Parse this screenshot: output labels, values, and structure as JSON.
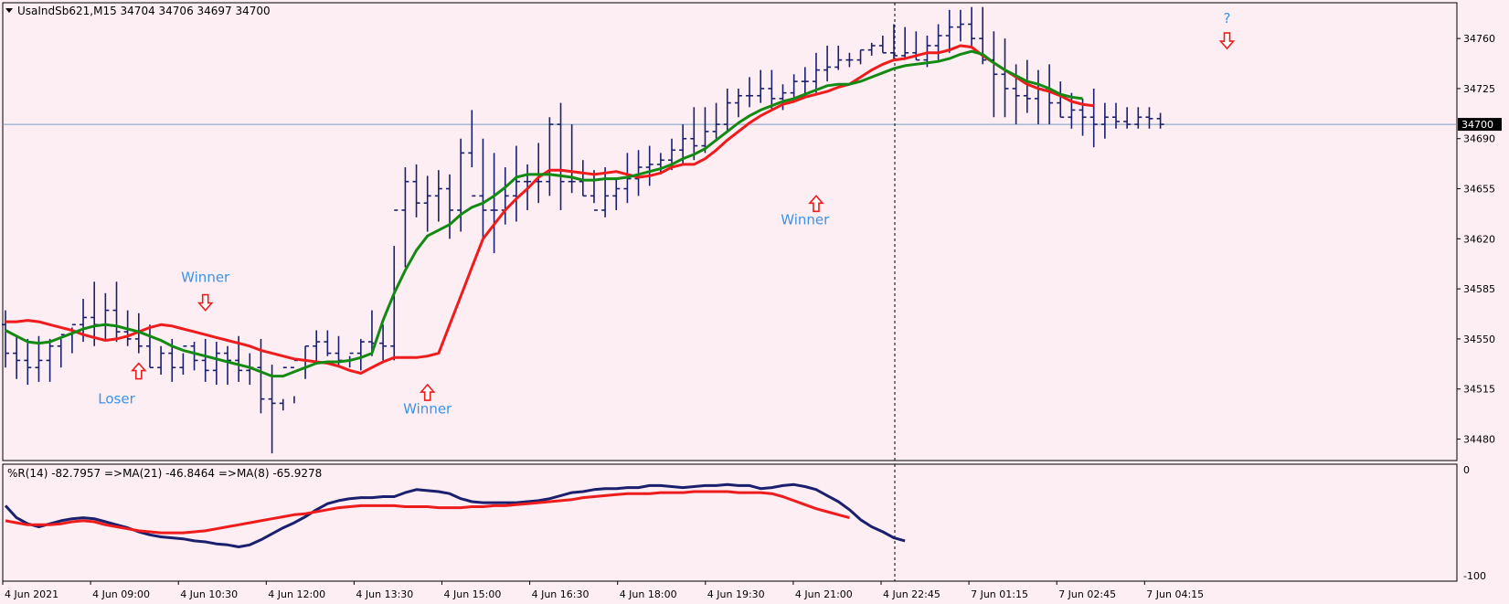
{
  "colors": {
    "background": "#fdeef3",
    "frame": "#000000",
    "bars": "#1a1f6e",
    "ma_fast": "#138a13",
    "ma_slow": "#ee1c1c",
    "wpr": "#1a1f6e",
    "wpr_ma": "#ee1c1c",
    "annotation_text": "#3b93e6",
    "arrow": "#ee1c1c",
    "price_line": "#7a9cc0",
    "price_tag_bg": "#000000",
    "price_tag_text": "#ffffff"
  },
  "header": {
    "symbol_info": "UsaIndSb621,M15  34704 34706 34697 34700",
    "collapse_icon": "triangle-down-icon"
  },
  "chart_data": [
    {
      "type": "ohlc",
      "panel": "main",
      "title": "UsaIndSb621,M15  34704 34706 34697 34700",
      "ylim": [
        34465,
        34785
      ],
      "y_ticks": [
        "34760",
        "34725",
        "34690",
        "34655",
        "34620",
        "34585",
        "34550",
        "34515",
        "34480"
      ],
      "current_price": {
        "value": 34700,
        "label": "34700"
      },
      "x_ticks": [
        "4 Jun 2021",
        "4 Jun 09:00",
        "4 Jun 10:30",
        "4 Jun 12:00",
        "4 Jun 13:30",
        "4 Jun 15:00",
        "4 Jun 16:30",
        "4 Jun 18:00",
        "4 Jun 19:30",
        "4 Jun 21:00",
        "4 Jun 22:45",
        "7 Jun 01:15",
        "7 Jun 02:45",
        "7 Jun 04:15"
      ],
      "bars_high": [
        34570,
        34552,
        34550,
        34552,
        34550,
        34550,
        34558,
        34578,
        34590,
        34582,
        34590,
        34570,
        34568,
        34560,
        34545,
        34550,
        34540,
        34548,
        34550,
        34548,
        34545,
        34552,
        34540,
        34550,
        34532,
        34508,
        34510,
        34545,
        34556,
        34556,
        34552,
        34538,
        34550,
        34570,
        34560,
        34615,
        34670,
        34672,
        34664,
        34668,
        34665,
        34690,
        34710,
        34690,
        34680,
        34670,
        34685,
        34672,
        34687,
        34705,
        34715,
        34700,
        34675,
        34668,
        34670,
        34662,
        34680,
        34682,
        34685,
        34680,
        34690,
        34700,
        34712,
        34712,
        34715,
        34725,
        34725,
        34733,
        34738,
        34738,
        34728,
        34735,
        34740,
        34750,
        34755,
        34755,
        34750,
        34752,
        34757,
        34762,
        34770,
        34768,
        34765,
        34762,
        34770,
        34780,
        34780,
        34782,
        34782,
        34765,
        34760,
        34742,
        34745,
        34738,
        34742,
        34730,
        34722,
        34718,
        34725,
        34715,
        34715,
        34712,
        34712,
        34712,
        34708
      ],
      "bars_low": [
        34530,
        34522,
        34518,
        34520,
        34520,
        34530,
        34540,
        34548,
        34545,
        34550,
        34548,
        34545,
        34540,
        34530,
        34525,
        34520,
        34525,
        34528,
        34520,
        34518,
        34518,
        34520,
        34518,
        34498,
        34470,
        34500,
        34505,
        34522,
        34532,
        34538,
        34530,
        34530,
        34528,
        34538,
        34535,
        34535,
        34600,
        34635,
        34625,
        34632,
        34620,
        34625,
        34670,
        34620,
        34610,
        34630,
        34632,
        34640,
        34645,
        34650,
        34640,
        34652,
        34650,
        34645,
        34635,
        34640,
        34645,
        34650,
        34657,
        34665,
        34668,
        34672,
        34675,
        34680,
        34690,
        34695,
        34705,
        34712,
        34715,
        34710,
        34710,
        34718,
        34720,
        34722,
        34730,
        34738,
        34740,
        34742,
        34748,
        34750,
        34745,
        34745,
        34745,
        34740,
        34745,
        34750,
        34758,
        34755,
        34742,
        34705,
        34705,
        34700,
        34708,
        34700,
        34700,
        34705,
        34697,
        34692,
        34684,
        34690,
        34697,
        34697,
        34697,
        34697,
        34697
      ],
      "bars_open": [
        34560,
        34540,
        34535,
        34530,
        34535,
        34545,
        34553,
        34560,
        34565,
        34560,
        34570,
        34555,
        34550,
        34545,
        34530,
        34540,
        34530,
        34545,
        34535,
        34528,
        34540,
        34535,
        34528,
        34530,
        34508,
        34505,
        34530,
        34535,
        34545,
        34548,
        34540,
        34535,
        34540,
        34548,
        34547,
        34545,
        34640,
        34660,
        34645,
        34650,
        34655,
        34640,
        34680,
        34650,
        34640,
        34640,
        34650,
        34660,
        34660,
        34660,
        34700,
        34660,
        34660,
        34650,
        34640,
        34650,
        34655,
        34662,
        34670,
        34672,
        34675,
        34682,
        34690,
        34685,
        34695,
        34700,
        34715,
        34720,
        34720,
        34725,
        34718,
        34722,
        34730,
        34730,
        34738,
        34740,
        34745,
        34745,
        34752,
        34755,
        34750,
        34748,
        34750,
        34745,
        34755,
        34762,
        34768,
        34770,
        34760,
        34745,
        34735,
        34725,
        34720,
        34718,
        34725,
        34715,
        34705,
        34710,
        34705,
        34700,
        34705,
        34702,
        34700,
        34705,
        34704
      ],
      "bars_close": [
        34540,
        34535,
        34530,
        34535,
        34545,
        34553,
        34560,
        34565,
        34560,
        34570,
        34555,
        34550,
        34545,
        34530,
        34540,
        34530,
        34545,
        34535,
        34528,
        34540,
        34535,
        34528,
        34530,
        34508,
        34505,
        34530,
        34535,
        34545,
        34548,
        34540,
        34535,
        34540,
        34548,
        34547,
        34545,
        34640,
        34660,
        34645,
        34650,
        34655,
        34640,
        34680,
        34650,
        34640,
        34640,
        34650,
        34660,
        34660,
        34660,
        34700,
        34660,
        34660,
        34650,
        34640,
        34650,
        34655,
        34662,
        34670,
        34672,
        34675,
        34682,
        34690,
        34685,
        34695,
        34700,
        34715,
        34720,
        34720,
        34725,
        34718,
        34722,
        34730,
        34730,
        34738,
        34740,
        34745,
        34745,
        34752,
        34755,
        34750,
        34748,
        34750,
        34745,
        34755,
        34762,
        34768,
        34770,
        34760,
        34745,
        34735,
        34725,
        34720,
        34718,
        34725,
        34715,
        34705,
        34710,
        34705,
        34700,
        34705,
        34702,
        34700,
        34705,
        34704,
        34700
      ],
      "ma_fast": [
        34556,
        34552,
        34548,
        34547,
        34548,
        34551,
        34554,
        34557,
        34559,
        34560,
        34559,
        34557,
        34555,
        34552,
        34549,
        34545,
        34542,
        34540,
        34538,
        34536,
        34534,
        34532,
        34530,
        34527,
        34524,
        34524,
        34527,
        34530,
        34533,
        34534,
        34534,
        34535,
        34537,
        34540,
        34563,
        34582,
        34598,
        34612,
        34622,
        34626,
        34630,
        34637,
        34642,
        34645,
        34650,
        34656,
        34663,
        34665,
        34665,
        34665,
        34664,
        34663,
        34661,
        34661,
        34662,
        34662,
        34663,
        34665,
        34667,
        34669,
        34672,
        34676,
        34679,
        34683,
        34689,
        34695,
        34701,
        34706,
        34710,
        34713,
        34716,
        34718,
        34721,
        34724,
        34727,
        34728,
        34728,
        34730,
        34733,
        34736,
        34739,
        34741,
        34742,
        34743,
        34744,
        34746,
        34749,
        34751,
        34749,
        34743,
        34738,
        34734,
        34730,
        34728,
        34725,
        34721,
        34719,
        34718
      ],
      "ma_slow": [
        34562,
        34562,
        34563,
        34562,
        34560,
        34558,
        34556,
        34553,
        34551,
        34549,
        34550,
        34552,
        34555,
        34558,
        34560,
        34559,
        34557,
        34555,
        34553,
        34551,
        34549,
        34547,
        34545,
        34542,
        34540,
        34538,
        34536,
        34535,
        34534,
        34533,
        34531,
        34528,
        34526,
        34530,
        34534,
        34537,
        34537,
        34537,
        34538,
        34540,
        34560,
        34580,
        34600,
        34620,
        34630,
        34640,
        34648,
        34655,
        34663,
        34668,
        34668,
        34667,
        34666,
        34665,
        34666,
        34667,
        34665,
        34663,
        34664,
        34666,
        34670,
        34672,
        34672,
        34676,
        34682,
        34689,
        34695,
        34701,
        34706,
        34710,
        34714,
        34716,
        34719,
        34721,
        34723,
        34726,
        34728,
        34733,
        34738,
        34742,
        34745,
        34746,
        34748,
        34750,
        34750,
        34752,
        34755,
        34754,
        34748,
        34743,
        34738,
        34733,
        34728,
        34725,
        34723,
        34720,
        34716,
        34714,
        34713
      ],
      "annotations": [
        {
          "text": "Winner",
          "kind": "label",
          "bar": 18,
          "price": 34590
        },
        {
          "text": "Loser",
          "kind": "label",
          "bar": 10,
          "price": 34505
        },
        {
          "text": "Winner",
          "kind": "label",
          "bar": 38,
          "price": 34498
        },
        {
          "text": "Winner",
          "kind": "label",
          "bar": 72,
          "price": 34630
        },
        {
          "text": "?",
          "kind": "label",
          "bar": 110,
          "price": 34771
        },
        {
          "text": "",
          "kind": "arrow-down",
          "bar": 18,
          "price": 34570
        },
        {
          "text": "",
          "kind": "arrow-up",
          "bar": 12,
          "price": 34533
        },
        {
          "text": "",
          "kind": "arrow-up",
          "bar": 38,
          "price": 34518
        },
        {
          "text": "",
          "kind": "arrow-up",
          "bar": 73,
          "price": 34650
        },
        {
          "text": "",
          "kind": "arrow-down",
          "bar": 110,
          "price": 34753
        }
      ]
    },
    {
      "type": "line",
      "panel": "indicator",
      "title": "%R(14) -82.7957  =>MA(21) -46.8464  =>MA(8) -65.9278",
      "ylim": [
        -100,
        0
      ],
      "y_ticks": [
        "0",
        "-100"
      ],
      "series": [
        {
          "name": "%R(14)",
          "color": "#1a1f6e",
          "values": [
            -34,
            -46,
            -52,
            -55,
            -52,
            -49,
            -47,
            -46,
            -47,
            -50,
            -53,
            -56,
            -60,
            -63,
            -65,
            -66,
            -67,
            -69,
            -70,
            -72,
            -73,
            -75,
            -73,
            -68,
            -62,
            -56,
            -51,
            -45,
            -38,
            -32,
            -29,
            -27,
            -26,
            -26,
            -25,
            -25,
            -21,
            -18,
            -19,
            -20,
            -22,
            -27,
            -30,
            -31,
            -31,
            -31,
            -31,
            -30,
            -29,
            -27,
            -24,
            -21,
            -20,
            -18,
            -17,
            -17,
            -16,
            -16,
            -14,
            -14,
            -15,
            -16,
            -15,
            -14,
            -14,
            -13,
            -14,
            -14,
            -17,
            -16,
            -14,
            -13,
            -15,
            -18,
            -24,
            -30,
            -38,
            -48,
            -55,
            -60,
            -66,
            -69
          ]
        },
        {
          "name": "MA(21)",
          "color": "#ee1c1c",
          "values": [
            -49,
            -51,
            -53,
            -53,
            -53,
            -52,
            -50,
            -49,
            -50,
            -53,
            -55,
            -57,
            -59,
            -60,
            -61,
            -61,
            -61,
            -60,
            -59,
            -57,
            -55,
            -53,
            -51,
            -49,
            -47,
            -45,
            -43,
            -42,
            -40,
            -38,
            -36,
            -35,
            -34,
            -34,
            -34,
            -34,
            -35,
            -35,
            -35,
            -36,
            -36,
            -36,
            -35,
            -35,
            -34,
            -34,
            -33,
            -32,
            -31,
            -30,
            -29,
            -28,
            -26,
            -25,
            -24,
            -23,
            -22,
            -22,
            -22,
            -21,
            -21,
            -21,
            -20,
            -20,
            -20,
            -20,
            -21,
            -21,
            -21,
            -22,
            -25,
            -29,
            -33,
            -37,
            -40,
            -43,
            -46
          ]
        }
      ]
    }
  ]
}
